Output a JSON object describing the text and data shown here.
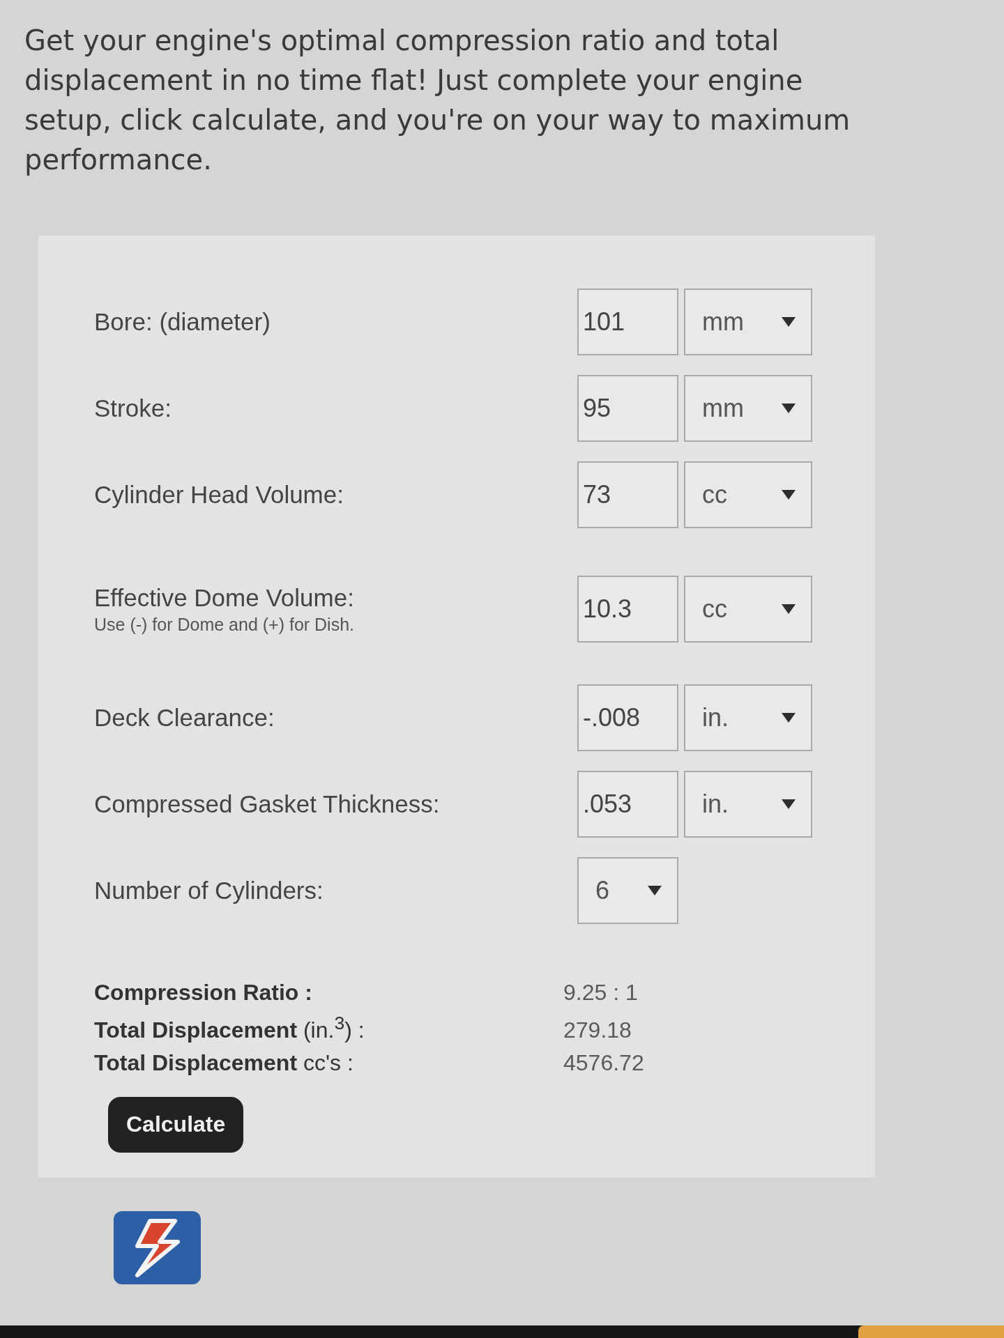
{
  "intro": "Get your engine's optimal compression ratio and total displacement in no time flat! Just complete your engine setup, click calculate, and you're on your way to maximum performance.",
  "fields": [
    {
      "kind": "number_unit",
      "label": "Bore: (diameter)",
      "value": "101",
      "unit": "mm"
    },
    {
      "kind": "number_unit",
      "label": "Stroke:",
      "value": "95",
      "unit": "mm"
    },
    {
      "kind": "number_unit",
      "label": "Cylinder Head Volume:",
      "value": "73",
      "unit": "cc"
    },
    {
      "kind": "number_unit",
      "label": "Effective Dome Volume:",
      "hint": "Use (-) for Dome and (+) for Dish.",
      "value": "10.3",
      "unit": "cc"
    },
    {
      "kind": "number_unit",
      "label": "Deck Clearance:",
      "value": "-.008",
      "unit": "in."
    },
    {
      "kind": "number_unit",
      "label": "Compressed Gasket Thickness:",
      "value": ".053",
      "unit": "in."
    },
    {
      "kind": "select",
      "label": "Number of Cylinders:",
      "value": "6"
    }
  ],
  "results": [
    {
      "label": "**Compression Ratio :**",
      "value": "9.25 : 1"
    },
    {
      "label": "**Total Displacement** (in.$^{3}$) :",
      "value": "279.18"
    },
    {
      "label": "**Total Displacement** cc's :",
      "value": "4576.72"
    }
  ],
  "calculate_button": "Calculate"
}
